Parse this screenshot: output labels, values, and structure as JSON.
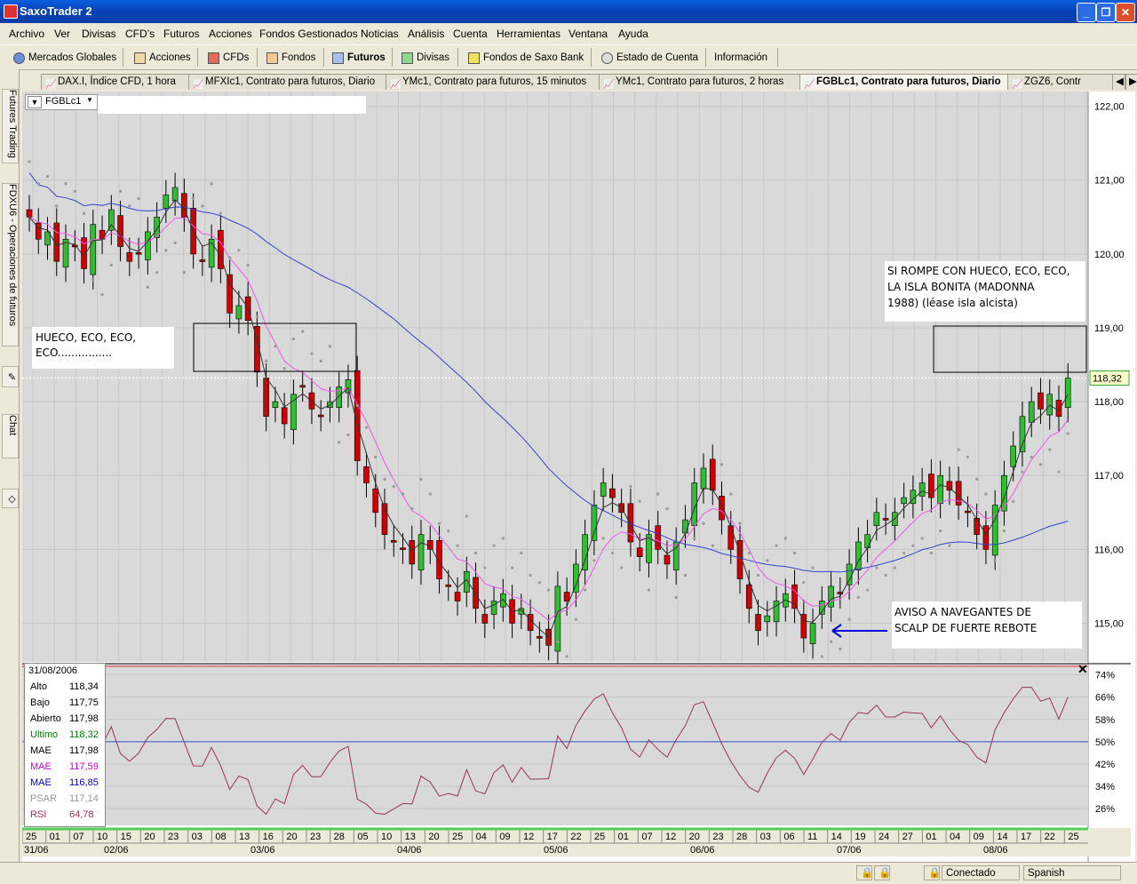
{
  "app": {
    "title": "SaxoTrader 2"
  },
  "menu": [
    "Archivo",
    "Ver",
    "Divisas",
    "CFD’s",
    "Futuros",
    "Acciones",
    "Fondos Gestionados",
    "Noticias",
    "Análisis",
    "Cuenta",
    "Herramientas",
    "Ventana",
    "Ayuda"
  ],
  "toolbar": [
    "Mercados Globales",
    "Acciones",
    "CFDs",
    "Fondos",
    "Futuros",
    "Divisas",
    "Fondos de Saxo Bank",
    "Estado de Cuenta",
    "Información"
  ],
  "tabs": [
    "DAX.I, Índice CFD, 1 hora",
    "MFXIc1, Contrato para futuros, Diario",
    "YMc1, Contrato para futuros, 15 minutos",
    "YMc1, Contrato para futuros, 2 horas",
    "FGBLc1, Contrato para futuros, Diario",
    "ZGZ6, Contr"
  ],
  "sidebar": [
    "Futures Trading",
    "FDXU6 - Operaciones de futuros",
    "Chat"
  ],
  "chart": {
    "symbol": "FGBLc1",
    "last_price_label": "118,32",
    "price_ticks": [
      "122,00",
      "121,00",
      "120,00",
      "119,00",
      "118,00",
      "117,00",
      "116,00",
      "115,00"
    ],
    "rsi_ticks": [
      "74%",
      "66%",
      "58%",
      "50%",
      "42%",
      "34%",
      "26%"
    ],
    "date_labels": [
      "25",
      "01",
      "07",
      "10",
      "15",
      "20",
      "23",
      "03",
      "08",
      "13",
      "16",
      "20",
      "23",
      "28",
      "05",
      "10",
      "13",
      "20",
      "25",
      "04",
      "09",
      "12",
      "17",
      "22",
      "25",
      "01",
      "07",
      "12",
      "20",
      "23",
      "28",
      "03",
      "06",
      "11",
      "14",
      "19",
      "24",
      "27",
      "01",
      "04",
      "09",
      "14",
      "17",
      "22",
      "25"
    ],
    "month_labels": [
      "31/06",
      "02/06",
      "03/06",
      "04/06",
      "05/06",
      "06/06",
      "07/06",
      "08/06"
    ],
    "annotations": {
      "left": [
        "HUECO, ECO, ECO,",
        "ECO................"
      ],
      "right": [
        "SI ROMPE CON HUECO, ECO, ECO,",
        "LA ISLA BONITA (MADONNA",
        "1988) (léase isla alcista)"
      ],
      "bottom": [
        "AVISO A NAVEGANTES DE",
        "SCALP DE FUERTE REBOTE"
      ]
    },
    "info": {
      "date": "31/08/2006",
      "rows": [
        {
          "label": "Alto",
          "value": "118,34",
          "color": "#000000"
        },
        {
          "label": "Bajo",
          "value": "117,75",
          "color": "#000000"
        },
        {
          "label": "Abierto",
          "value": "117,98",
          "color": "#000000"
        },
        {
          "label": "Ultimo",
          "value": "118,32",
          "color": "#008000"
        },
        {
          "label": "MAE",
          "value": "117,98",
          "color": "#000000"
        },
        {
          "label": "MAE",
          "value": "117,59",
          "color": "#cc00cc"
        },
        {
          "label": "MAE",
          "value": "116,85",
          "color": "#0000cc"
        },
        {
          "label": "PSAR",
          "value": "117,14",
          "color": "#999999"
        },
        {
          "label": "RSI",
          "value": "64,78",
          "color": "#993355"
        }
      ]
    }
  },
  "chart_data": {
    "type": "candlestick",
    "price_range": [
      114.5,
      122.2
    ],
    "series_colors": {
      "up": "#33bb33",
      "down": "#cc0000",
      "ma_fast": "#333333",
      "ma_mid": "#ee55ee",
      "ma_slow": "#3344cc",
      "psar": "#999999",
      "rsi": "#993355"
    },
    "close": [
      120.5,
      120.2,
      120.3,
      119.9,
      120.2,
      120.1,
      119.8,
      120.4,
      120.2,
      120.6,
      120.1,
      119.9,
      120.0,
      120.3,
      120.5,
      120.8,
      120.9,
      120.5,
      120.0,
      119.9,
      120.2,
      119.8,
      119.2,
      119.3,
      119.1,
      118.4,
      117.8,
      118.0,
      117.7,
      118.1,
      118.2,
      117.9,
      117.8,
      118.0,
      118.2,
      118.3,
      117.2,
      116.9,
      116.5,
      116.2,
      116.1,
      116.0,
      115.8,
      116.2,
      116.0,
      115.6,
      115.5,
      115.3,
      115.7,
      115.2,
      115.0,
      115.3,
      115.4,
      115.0,
      115.2,
      114.9,
      114.8,
      114.7,
      115.5,
      115.3,
      115.8,
      116.2,
      116.6,
      116.9,
      116.7,
      116.5,
      116.1,
      115.9,
      116.2,
      116.0,
      115.8,
      116.1,
      116.4,
      116.9,
      117.1,
      116.8,
      116.4,
      116.0,
      115.6,
      115.2,
      114.9,
      115.1,
      115.3,
      115.4,
      115.2,
      114.8,
      115.0,
      115.3,
      115.5,
      115.4,
      115.8,
      116.1,
      116.2,
      116.5,
      116.4,
      116.5,
      116.7,
      116.8,
      116.9,
      116.7,
      117.0,
      116.8,
      116.6,
      116.5,
      116.2,
      116.0,
      116.6,
      117.0,
      117.4,
      117.8,
      118.0,
      117.9,
      118.1,
      117.8,
      118.32
    ],
    "rsi_range": [
      20,
      78
    ]
  },
  "status": {
    "connection": "Conectado",
    "language": "Spanish"
  }
}
